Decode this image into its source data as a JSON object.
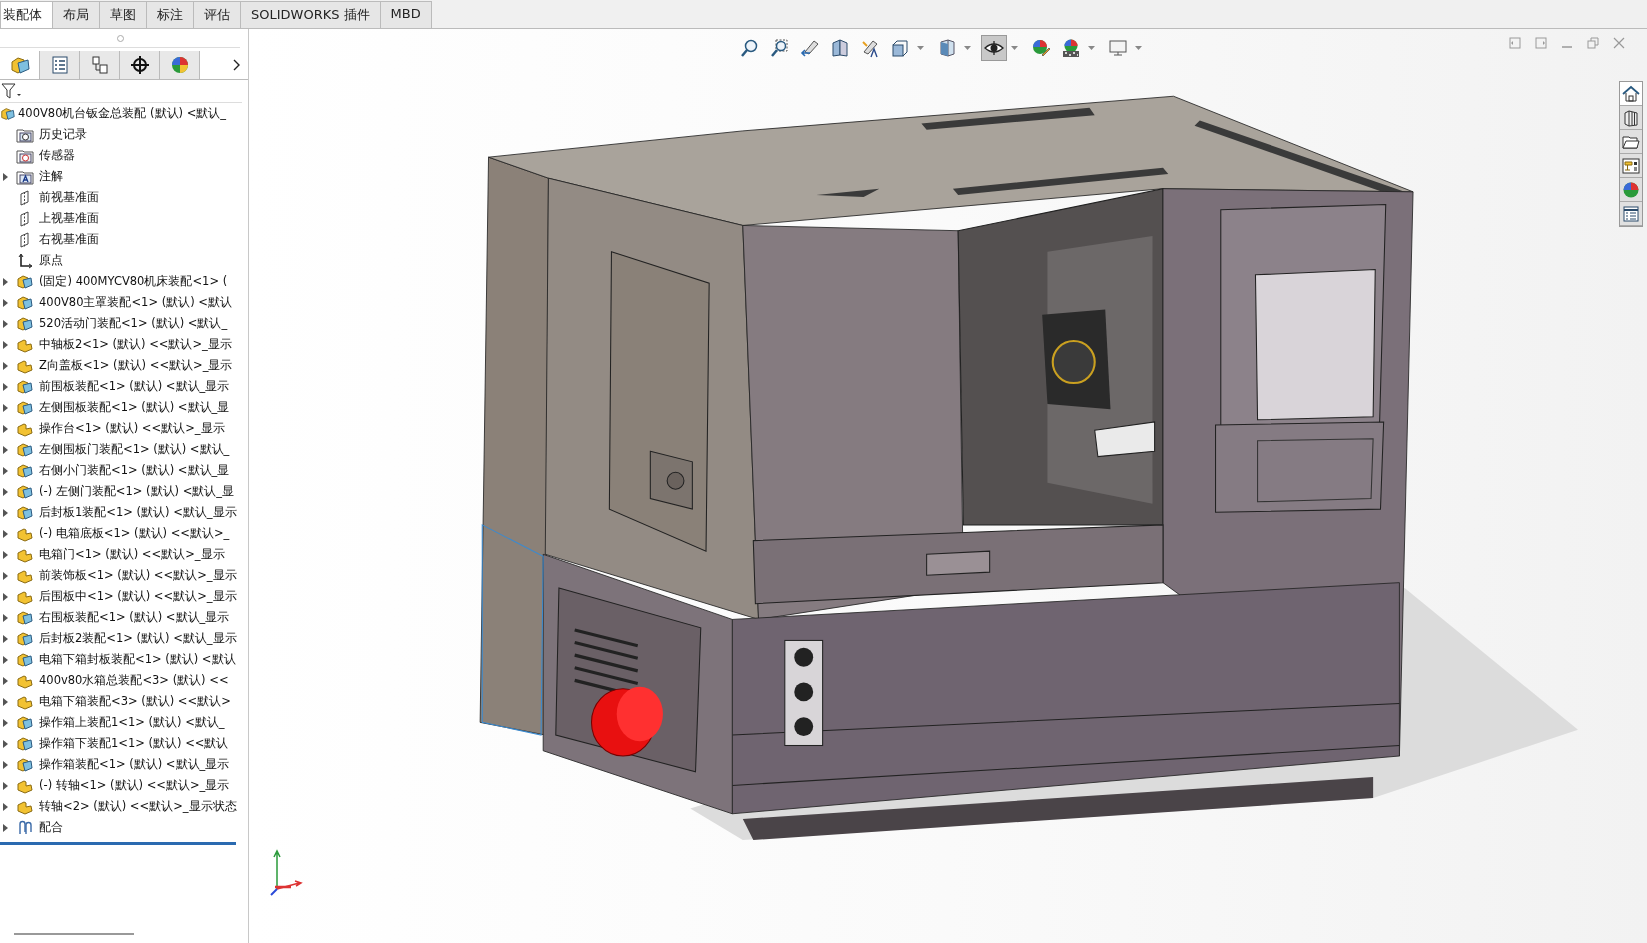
{
  "command_tabs": [
    {
      "label": "装配体",
      "selected": true
    },
    {
      "label": "布局",
      "selected": false
    },
    {
      "label": "草图",
      "selected": false
    },
    {
      "label": "标注",
      "selected": false
    },
    {
      "label": "评估",
      "selected": false
    },
    {
      "label": "SOLIDWORKS 插件",
      "selected": false
    },
    {
      "label": "MBD",
      "selected": false
    }
  ],
  "panel_tabs": [
    {
      "kind": "tree",
      "selected": true
    },
    {
      "kind": "property",
      "selected": false
    },
    {
      "kind": "config",
      "selected": false
    },
    {
      "kind": "target",
      "selected": false
    },
    {
      "kind": "appearance",
      "selected": false
    }
  ],
  "feature_tree": {
    "root": "400V80机台钣金总装配 (默认) <默认_",
    "items": [
      {
        "kind": "history",
        "label": "历史记录",
        "expandable": false
      },
      {
        "kind": "sensor",
        "label": "传感器",
        "expandable": false
      },
      {
        "kind": "annotation",
        "label": "注解",
        "expandable": true
      },
      {
        "kind": "plane",
        "label": "前视基准面",
        "expandable": false
      },
      {
        "kind": "plane",
        "label": "上视基准面",
        "expandable": false
      },
      {
        "kind": "plane",
        "label": "右视基准面",
        "expandable": false
      },
      {
        "kind": "origin",
        "label": "原点",
        "expandable": false
      },
      {
        "kind": "assembly",
        "label": "(固定) 400MYCV80机床装配<1> (",
        "expandable": true
      },
      {
        "kind": "assembly",
        "label": "400V80主罩装配<1> (默认) <默认",
        "expandable": true
      },
      {
        "kind": "assembly",
        "label": "520活动门装配<1> (默认) <默认_",
        "expandable": true
      },
      {
        "kind": "part",
        "label": "中轴板2<1> (默认) <<默认>_显示",
        "expandable": true
      },
      {
        "kind": "part",
        "label": "Z向盖板<1> (默认) <<默认>_显示",
        "expandable": true
      },
      {
        "kind": "assembly",
        "label": "前围板装配<1> (默认) <默认_显示",
        "expandable": true
      },
      {
        "kind": "assembly",
        "label": "左侧围板装配<1> (默认) <默认_显",
        "expandable": true
      },
      {
        "kind": "part",
        "label": "操作台<1> (默认) <<默认>_显示",
        "expandable": true
      },
      {
        "kind": "assembly",
        "label": "左侧围板门装配<1> (默认) <默认_",
        "expandable": true
      },
      {
        "kind": "assembly",
        "label": "右侧小门装配<1> (默认) <默认_显",
        "expandable": true
      },
      {
        "kind": "assembly",
        "label": "(-) 左侧门装配<1> (默认) <默认_显",
        "expandable": true
      },
      {
        "kind": "assembly",
        "label": "后封板1装配<1> (默认) <默认_显示",
        "expandable": true
      },
      {
        "kind": "part",
        "label": "(-) 电箱底板<1> (默认) <<默认>_",
        "expandable": true
      },
      {
        "kind": "part",
        "label": "电箱门<1> (默认) <<默认>_显示",
        "expandable": true
      },
      {
        "kind": "part",
        "label": "前装饰板<1> (默认) <<默认>_显示",
        "expandable": true
      },
      {
        "kind": "part",
        "label": "后围板中<1> (默认) <<默认>_显示",
        "expandable": true
      },
      {
        "kind": "assembly",
        "label": "右围板装配<1> (默认) <默认_显示",
        "expandable": true
      },
      {
        "kind": "assembly",
        "label": "后封板2装配<1> (默认) <默认_显示",
        "expandable": true
      },
      {
        "kind": "assembly",
        "label": "电箱下箱封板装配<1> (默认) <默认",
        "expandable": true
      },
      {
        "kind": "part",
        "label": "400v80水箱总装配<3> (默认) <<",
        "expandable": true
      },
      {
        "kind": "part",
        "label": "电箱下箱装配<3> (默认) <<默认>",
        "expandable": true
      },
      {
        "kind": "assembly",
        "label": "操作箱上装配1<1> (默认) <默认_",
        "expandable": true
      },
      {
        "kind": "assembly",
        "label": "操作箱下装配1<1> (默认) <<默认",
        "expandable": true
      },
      {
        "kind": "assembly",
        "label": "操作箱装配<1> (默认) <默认_显示",
        "expandable": true
      },
      {
        "kind": "part",
        "label": "(-) 转轴<1> (默认) <<默认>_显示",
        "expandable": true
      },
      {
        "kind": "part",
        "label": "转轴<2> (默认) <<默认>_显示状态",
        "expandable": true
      },
      {
        "kind": "mates",
        "label": "配合",
        "expandable": true
      }
    ]
  },
  "view_toolbar": [
    {
      "kind": "zoom-fit",
      "selected": false,
      "dropdown": false
    },
    {
      "kind": "zoom-area",
      "selected": false,
      "dropdown": false
    },
    {
      "kind": "previous-view",
      "selected": false,
      "dropdown": false
    },
    {
      "kind": "section",
      "selected": false,
      "dropdown": false
    },
    {
      "kind": "dynamic-annotation",
      "selected": false,
      "dropdown": false
    },
    {
      "kind": "view-orientation",
      "selected": false,
      "dropdown": true
    },
    {
      "kind": "display-style",
      "selected": false,
      "dropdown": true
    },
    {
      "kind": "hide-show",
      "selected": true,
      "dropdown": true
    },
    {
      "kind": "edit-appearance",
      "selected": false,
      "dropdown": false
    },
    {
      "kind": "scene",
      "selected": false,
      "dropdown": true
    },
    {
      "kind": "display-settings",
      "selected": false,
      "dropdown": true
    }
  ],
  "task_pane": [
    {
      "kind": "home",
      "selected": true
    },
    {
      "kind": "library",
      "selected": false
    },
    {
      "kind": "folder",
      "selected": false
    },
    {
      "kind": "palette",
      "selected": false
    },
    {
      "kind": "appearance",
      "selected": false
    },
    {
      "kind": "properties",
      "selected": false
    }
  ]
}
